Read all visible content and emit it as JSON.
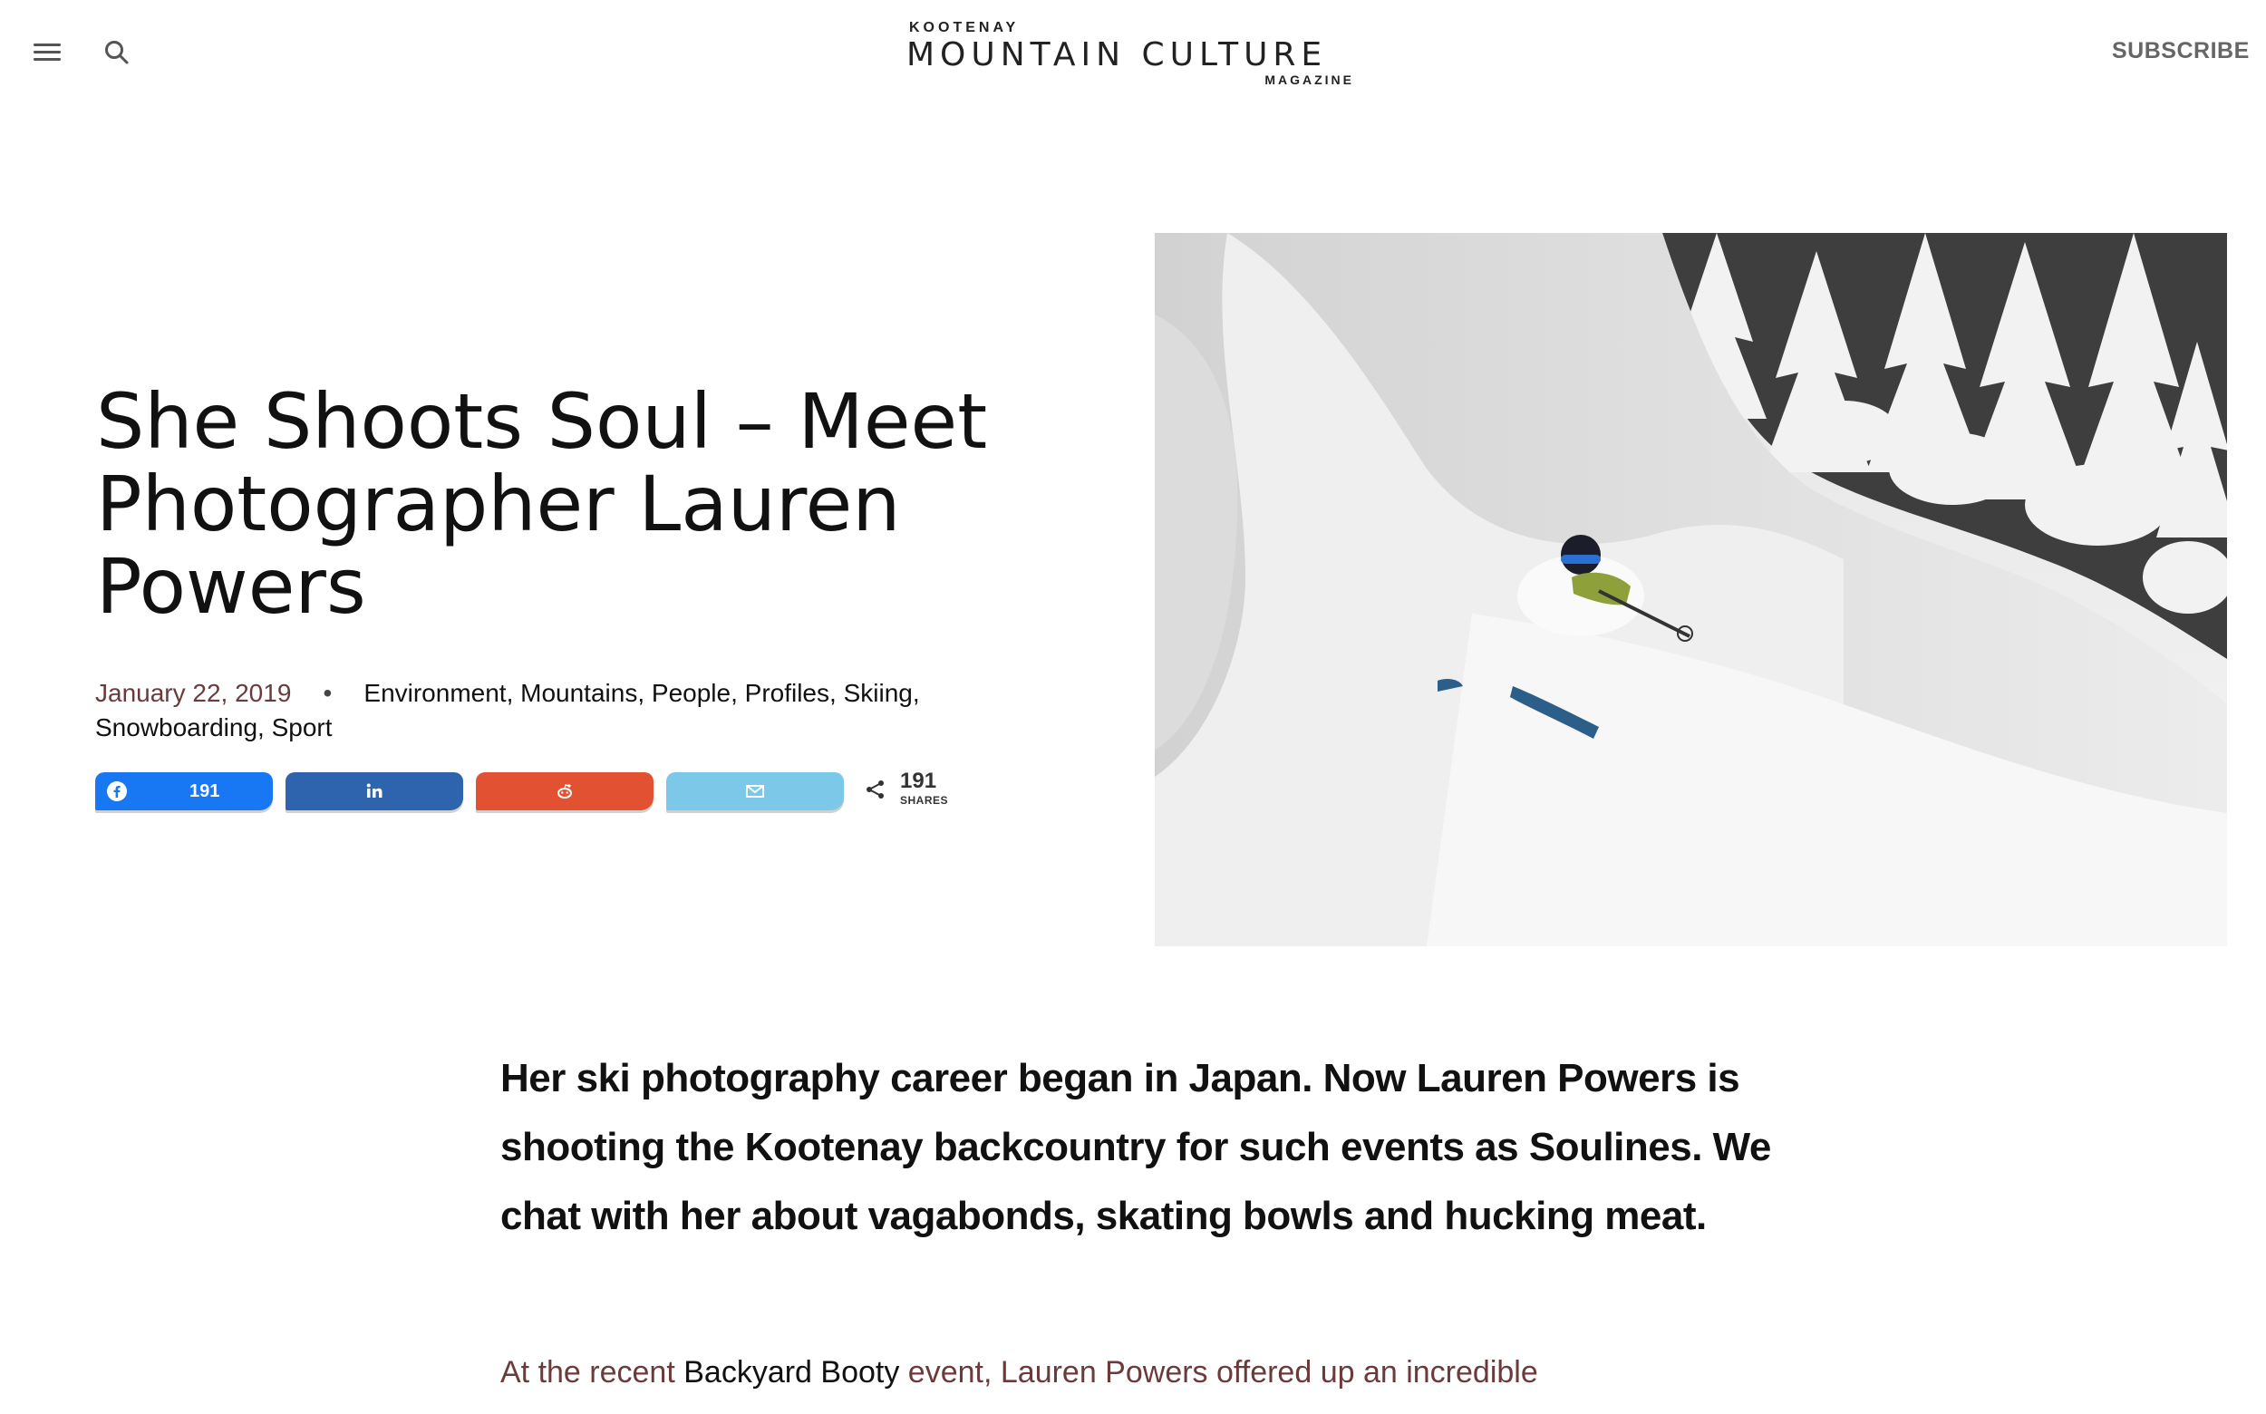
{
  "header": {
    "logo_top": "KOOTENAY",
    "logo_main": "MOUNTAIN CULTURE",
    "logo_bottom": "MAGAZINE",
    "subscribe_label": "SUBSCRIBE",
    "menu_icon": "hamburger-icon",
    "search_icon": "search-icon"
  },
  "article": {
    "title": "She Shoots Soul – Meet Photographer Lauren Powers",
    "date": "January 22, 2019",
    "separator": "•",
    "categories": [
      "Environment",
      "Mountains",
      "People",
      "Profiles",
      "Skiing",
      "Snowboarding",
      "Sport"
    ],
    "hero_image_alt": "",
    "lead": "Her ski photography career began in Japan. Now Lauren Powers is shooting the Kootenay backcountry for such events as Soulines. We chat with her about vagabonds, skating bowls and hucking meat.",
    "body_intro_start": "At the recent ",
    "body_link": "Backyard Booty",
    "body_intro_end": " event, Lauren Powers offered up an incredible"
  },
  "share": {
    "facebook_count": "191",
    "facebook_icon": "facebook-icon",
    "linkedin_icon": "linkedin-icon",
    "reddit_icon": "reddit-icon",
    "email_icon": "email-icon",
    "total_count": "191",
    "total_label": "SHARES",
    "colors": {
      "facebook": "#1877f2",
      "linkedin": "#2e63ad",
      "reddit": "#e25232",
      "email": "#7cc8e8"
    }
  },
  "colors": {
    "accent_text": "#6b3b3b"
  }
}
